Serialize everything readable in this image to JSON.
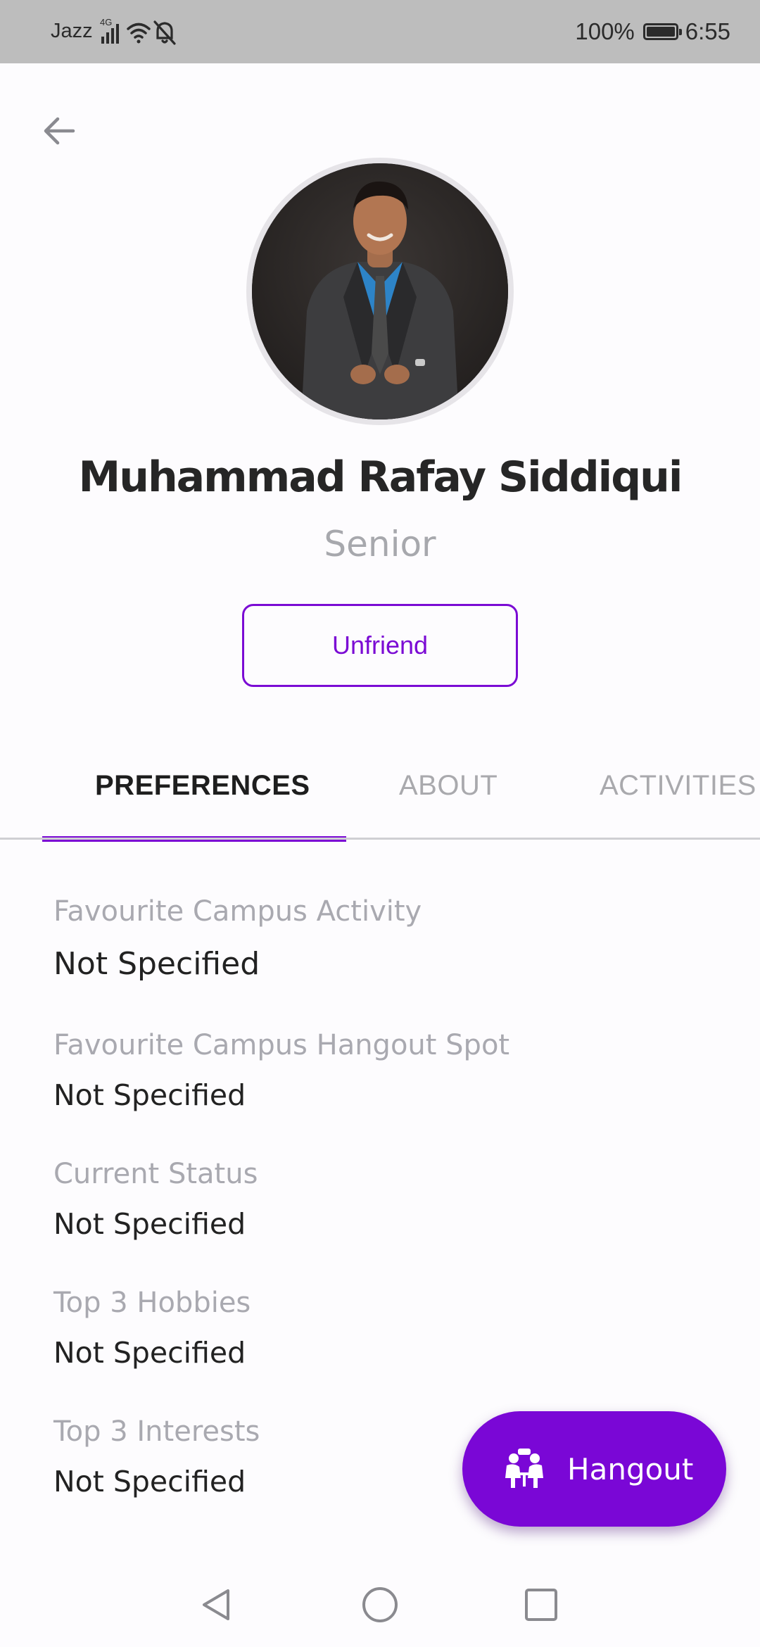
{
  "status_bar": {
    "carrier": "Jazz",
    "network": "4G",
    "battery": "100%",
    "time": "6:55"
  },
  "profile": {
    "name": "Muhammad Rafay Siddiqui",
    "level": "Senior",
    "unfriend_label": "Unfriend"
  },
  "tabs": [
    {
      "label": "PREFERENCES",
      "active": true
    },
    {
      "label": "ABOUT",
      "active": false
    },
    {
      "label": "ACTIVITIES",
      "active": false
    }
  ],
  "preferences": [
    {
      "label": "Favourite Campus Activity",
      "value": "Not Specified"
    },
    {
      "label": "Favourite Campus Hangout Spot",
      "value": "Not Specified"
    },
    {
      "label": "Current Status",
      "value": "Not Specified"
    },
    {
      "label": "Top 3 Hobbies",
      "value": "Not Specified"
    },
    {
      "label": "Top 3 Interests",
      "value": "Not Specified"
    }
  ],
  "fab": {
    "label": "Hangout",
    "icon": "meeting-people-icon"
  },
  "colors": {
    "accent": "#7b0bd4",
    "status_bar": "#bdbdbd",
    "muted_text": "#a9a9b0"
  },
  "icons": {
    "back": "arrow-left-icon",
    "nav_back": "triangle-back-icon",
    "nav_home": "circle-home-icon",
    "nav_recents": "square-recents-icon"
  }
}
